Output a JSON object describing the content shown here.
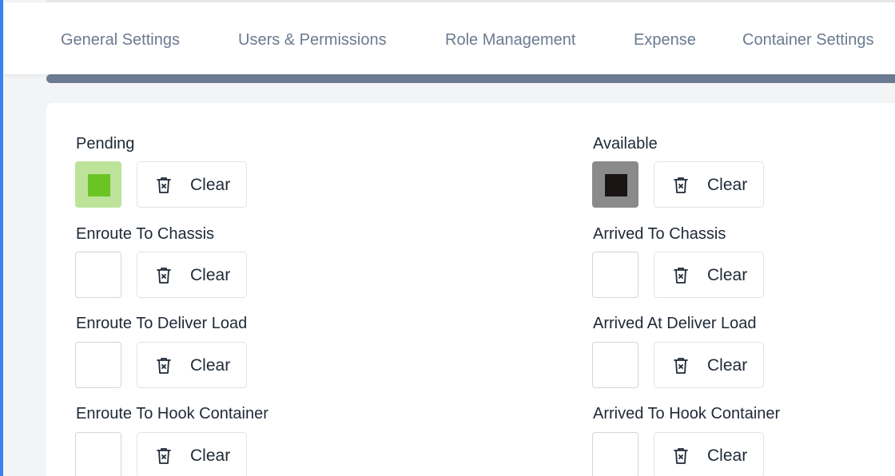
{
  "tabs": [
    {
      "label": "General Settings"
    },
    {
      "label": "Users & Permissions"
    },
    {
      "label": "Role Management"
    },
    {
      "label": "Expense"
    },
    {
      "label": "Container Settings"
    }
  ],
  "clear_label": "Clear",
  "icons": {
    "clear": "trash-x-icon"
  },
  "colors": {
    "accent": "#3b82f6",
    "pending_swatch_bg": "#bde39a",
    "pending_color": "#6cc424",
    "available_swatch_bg": "#8a8a8a",
    "available_color": "#1a1414"
  },
  "statuses": {
    "pending": {
      "label": "Pending"
    },
    "available": {
      "label": "Available"
    },
    "enroute_chassis": {
      "label": "Enroute To Chassis"
    },
    "arrived_chassis": {
      "label": "Arrived To Chassis"
    },
    "enroute_deliver": {
      "label": "Enroute To Deliver Load"
    },
    "arrived_deliver": {
      "label": "Arrived At Deliver Load"
    },
    "enroute_hook": {
      "label": "Enroute To Hook Container"
    },
    "arrived_hook": {
      "label": "Arrived To Hook Container"
    }
  }
}
